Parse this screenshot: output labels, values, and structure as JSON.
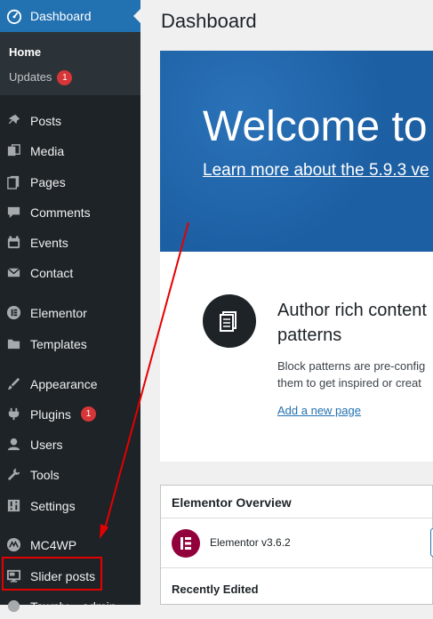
{
  "sidebar": {
    "dashboard_label": "Dashboard",
    "submenu": {
      "home": "Home",
      "updates": "Updates",
      "updates_count": "1"
    },
    "items": [
      {
        "label": "Posts",
        "icon": "pushpin-icon"
      },
      {
        "label": "Media",
        "icon": "media-icon"
      },
      {
        "label": "Pages",
        "icon": "pages-icon"
      },
      {
        "label": "Comments",
        "icon": "comments-icon"
      },
      {
        "label": "Events",
        "icon": "events-icon"
      },
      {
        "label": "Contact",
        "icon": "envelope-icon"
      },
      {
        "label": "Elementor",
        "icon": "elementor-icon"
      },
      {
        "label": "Templates",
        "icon": "folder-icon"
      },
      {
        "label": "Appearance",
        "icon": "brush-icon"
      },
      {
        "label": "Plugins",
        "icon": "plugin-icon",
        "badge": "1"
      },
      {
        "label": "Users",
        "icon": "user-icon"
      },
      {
        "label": "Tools",
        "icon": "wrench-icon"
      },
      {
        "label": "Settings",
        "icon": "sliders-icon"
      },
      {
        "label": "MC4WP",
        "icon": "mc4wp-icon"
      },
      {
        "label": "Slider posts",
        "icon": "monitor-icon"
      },
      {
        "label": "Townly – admin",
        "icon": "townly-icon"
      }
    ]
  },
  "main": {
    "page_title": "Dashboard",
    "welcome": {
      "heading": "Welcome to",
      "link": "Learn more about the 5.9.3 ve"
    },
    "patterns": {
      "title": "Author rich content patterns",
      "description_line1": "Block patterns are pre-config",
      "description_line2": "them to get inspired or creat",
      "link": "Add a new page"
    },
    "elementor_widget": {
      "title": "Elementor Overview",
      "version": "Elementor v3.6.2",
      "recently_edited": "Recently Edited"
    }
  },
  "colors": {
    "sidebar_bg": "#1d2327",
    "active_bg": "#2271b1",
    "badge": "#d63638",
    "annotation": "#e50000",
    "elementor_brand": "#92003b"
  }
}
